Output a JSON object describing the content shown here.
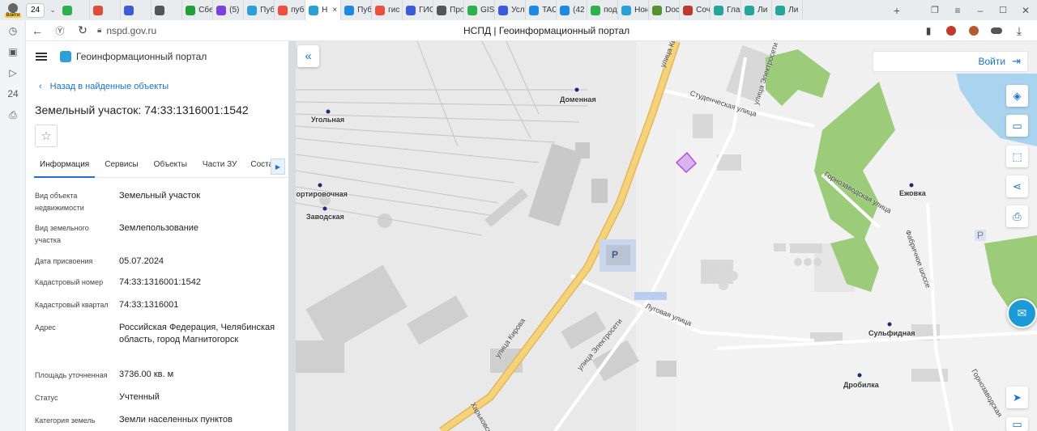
{
  "browser": {
    "first_tab_badge": "24",
    "profile_label": "Войти",
    "tabs": [
      {
        "label": "",
        "color": "#2bb24c"
      },
      {
        "label": "",
        "color": "#e24a3b"
      },
      {
        "label": "",
        "color": "#3b5bdb"
      },
      {
        "label": "",
        "color": "#555"
      },
      {
        "label": "Сбе",
        "color": "#21a038"
      },
      {
        "label": "(5)",
        "color": "#7b3fe4"
      },
      {
        "label": "Пуб",
        "color": "#2ba0d8"
      },
      {
        "label": "пуб",
        "color": "#f04d3a"
      },
      {
        "label": "Н",
        "color": "#2ba0d8"
      },
      {
        "label": "Пуб",
        "color": "#1e88e5"
      },
      {
        "label": "гис",
        "color": "#f04d3a"
      },
      {
        "label": "ГИС",
        "color": "#3b5bdb"
      },
      {
        "label": "Про",
        "color": "#555"
      },
      {
        "label": "GIS",
        "color": "#2bb24c"
      },
      {
        "label": "Усл",
        "color": "#3b5bdb"
      },
      {
        "label": "TAC",
        "color": "#1e88e5"
      },
      {
        "label": "(42",
        "color": "#1e88e5"
      },
      {
        "label": "под",
        "color": "#2bb24c"
      },
      {
        "label": "Нон",
        "color": "#2ba0d8"
      },
      {
        "label": "Doc",
        "color": "#5a8f2e"
      },
      {
        "label": "Соч",
        "color": "#c0392b"
      },
      {
        "label": "Гла",
        "color": "#26a69a"
      },
      {
        "label": "Ли",
        "color": "#26a69a"
      },
      {
        "label": "Ли",
        "color": "#26a69a"
      }
    ],
    "active_tab": 8,
    "url": "nspd.gov.ru",
    "page_title": "НСПД | Геоинформационный портал"
  },
  "panel": {
    "portal_name": "Геоинформационный портал",
    "back_link": "Назад в найденные объекты",
    "title": "Земельный участок: 74:33:1316001:1542",
    "tabs": [
      "Информация",
      "Сервисы",
      "Объекты",
      "Части ЗУ",
      "Соста"
    ],
    "rows": [
      {
        "label": "Вид объекта недвижимости",
        "value": "Земельный участок"
      },
      {
        "label": "Вид земельного участка",
        "value": "Землепользование"
      },
      {
        "label": "Дата присвоения",
        "value": "05.07.2024"
      },
      {
        "label": "Кадастровый номер",
        "value": "74:33:1316001:1542"
      },
      {
        "label": "Кадастровый квартал",
        "value": "74:33:1316001"
      },
      {
        "label": "Адрес",
        "value": "Российская Федерация, Челябинская область, город Магнитогорск"
      },
      {
        "label": "Площадь уточненная",
        "value": "3736.00 кв. м"
      },
      {
        "label": "Статус",
        "value": "Учтенный"
      },
      {
        "label": "Категория земель",
        "value": "Земли населенных пунктов"
      }
    ]
  },
  "map": {
    "login_label": "Войти",
    "stations": [
      "Угольная",
      "Доменная",
      "Сортировочная",
      "Заводская",
      "Ежовка",
      "Сульфидная",
      "Дробилка"
    ],
    "streets": [
      "улица Кирова",
      "Студенческая улица",
      "улица Электросети",
      "Горнозаводская улица",
      "Луговая улица",
      "Фабричное шоссе",
      "Харьковская",
      "Горнозаводская"
    ],
    "parking_label": "P",
    "colors": {
      "road_main": "#f6d27a",
      "green": "#9ccc7a",
      "water": "#aad3f0",
      "parcel": "#b84dd6",
      "accent": "#1a73c9"
    }
  }
}
